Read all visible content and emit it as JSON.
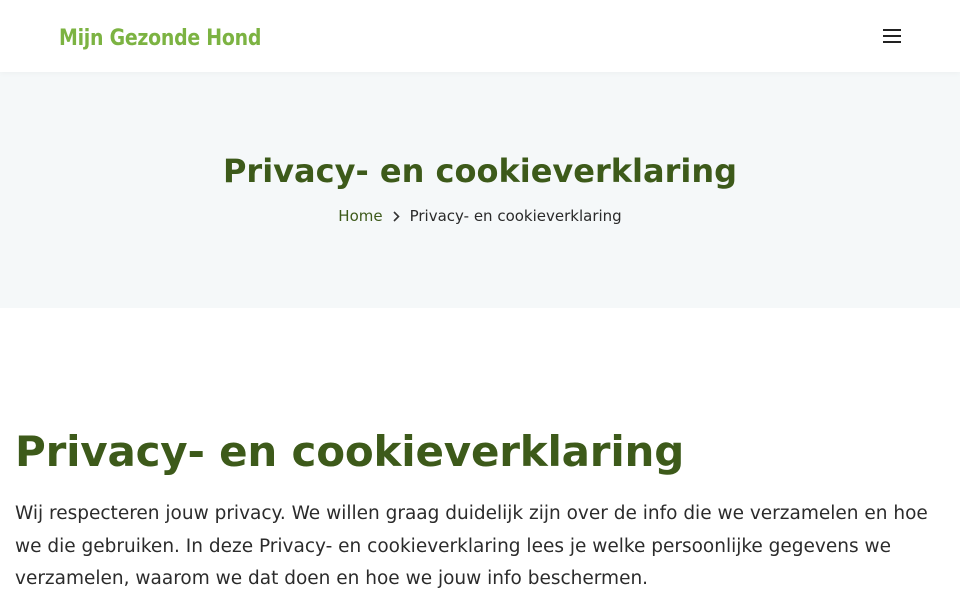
{
  "header": {
    "logo_text": "Mijn Gezonde Hond",
    "menu_icon": "hamburger-menu-icon"
  },
  "hero": {
    "title": "Privacy- en cookieverklaring",
    "breadcrumb": {
      "home_label": "Home",
      "separator_icon": "chevron-right-icon",
      "current_label": "Privacy- en cookieverklaring"
    }
  },
  "main": {
    "heading": "Privacy- en cookieverklaring",
    "intro": "Wij respecteren jouw privacy. We willen graag duidelijk zijn over de info die we verzamelen en hoe we die gebruiken. In deze Privacy- en cookieverklaring lees je welke persoonlijke gegevens we verzamelen, waarom we dat doen en hoe we jouw info beschermen."
  },
  "colors": {
    "brand_green": "#7cb342",
    "heading_green": "#3d5a1a",
    "hero_background": "#f5f8f9"
  }
}
